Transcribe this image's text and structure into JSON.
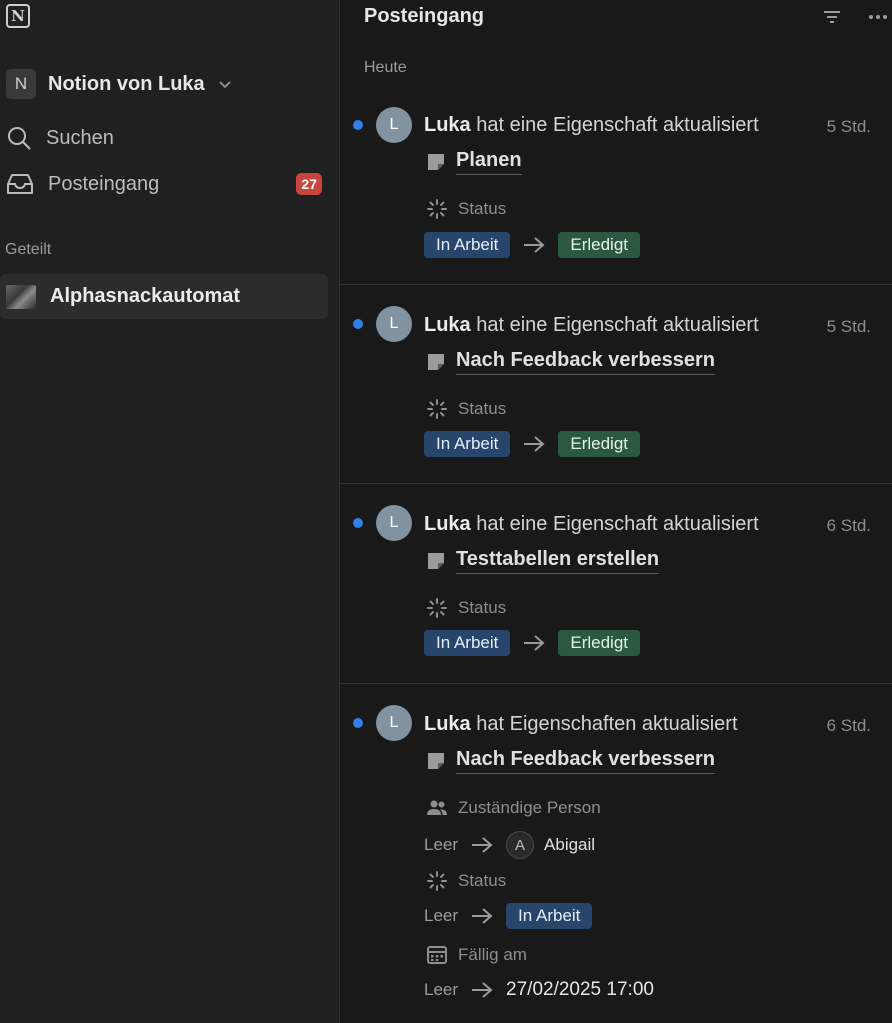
{
  "sidebar": {
    "logo": "N",
    "workspace": {
      "avatar": "N",
      "name": "Notion von Luka"
    },
    "nav": [
      {
        "label": "Suchen",
        "icon": "search-icon"
      },
      {
        "label": "Posteingang",
        "icon": "inbox-icon",
        "badge": "27"
      }
    ],
    "section_label": "Geteilt",
    "pages": [
      {
        "label": "Alphasnackautomat"
      }
    ]
  },
  "main": {
    "title": "Posteingang",
    "group_label": "Heute",
    "notifications": [
      {
        "actor": "Luka",
        "action": "hat eine Eigenschaft aktualisiert",
        "time": "5 Std.",
        "avatar": "L",
        "page": "Planen",
        "props": [
          {
            "label": "Status",
            "from": "In Arbeit",
            "to": "Erledigt"
          }
        ]
      },
      {
        "actor": "Luka",
        "action": "hat eine Eigenschaft aktualisiert",
        "time": "5 Std.",
        "avatar": "L",
        "page": "Nach Feedback verbessern",
        "props": [
          {
            "label": "Status",
            "from": "In Arbeit",
            "to": "Erledigt"
          }
        ]
      },
      {
        "actor": "Luka",
        "action": "hat eine Eigenschaft aktualisiert",
        "time": "6 Std.",
        "avatar": "L",
        "page": "Testtabellen erstellen",
        "props": [
          {
            "label": "Status",
            "from": "In Arbeit",
            "to": "Erledigt"
          }
        ]
      },
      {
        "actor": "Luka",
        "action": "hat Eigenschaften aktualisiert",
        "time": "6 Std.",
        "avatar": "L",
        "page": "Nach Feedback verbessern",
        "props": [
          {
            "label": "Zuständige Person",
            "from": "Leer",
            "to": "Abigail",
            "to_avatar": "A"
          },
          {
            "label": "Status",
            "from": "Leer",
            "to": "In Arbeit"
          },
          {
            "label": "Fällig am",
            "from": "Leer",
            "to": "27/02/2025 17:00"
          }
        ]
      }
    ]
  },
  "colors": {
    "accent_dot": "#2f80ed",
    "badge": "#c8453d",
    "tag_blue": "#28456c",
    "tag_green": "#2b593f"
  }
}
